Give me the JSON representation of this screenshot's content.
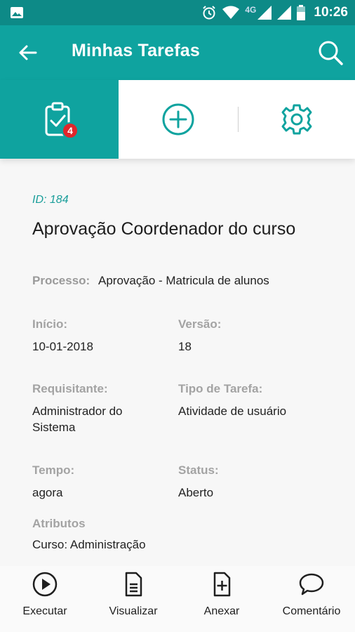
{
  "statusbar": {
    "network": "4G",
    "time": "10:26"
  },
  "appbar": {
    "title": "Minhas Tarefas"
  },
  "tabs": {
    "tasks_badge": "4"
  },
  "task": {
    "id": "ID: 184",
    "title": "Aprovação Coordenador do curso",
    "process_label": "Processo:",
    "process_value": "Aprovação - Matricula de alunos",
    "start_label": "Início:",
    "start_value": "10-01-2018",
    "version_label": "Versão:",
    "version_value": "18",
    "requester_label": "Requisitante:",
    "requester_value": "Administrador do Sistema",
    "task_type_label": "Tipo de Tarefa:",
    "task_type_value": "Atividade de usuário",
    "time_label": "Tempo:",
    "time_value": "agora",
    "status_label": "Status:",
    "status_value": "Aberto",
    "attributes_label": "Atributos",
    "attributes_value": "Curso: Administração"
  },
  "actions": {
    "execute": "Executar",
    "view": "Visualizar",
    "attach": "Anexar",
    "comment": "Comentário"
  },
  "colors": {
    "primary": "#0fa39f",
    "primary_dark": "#0d8a87",
    "badge": "#e0262b",
    "accent_text": "#1a9e9a"
  }
}
